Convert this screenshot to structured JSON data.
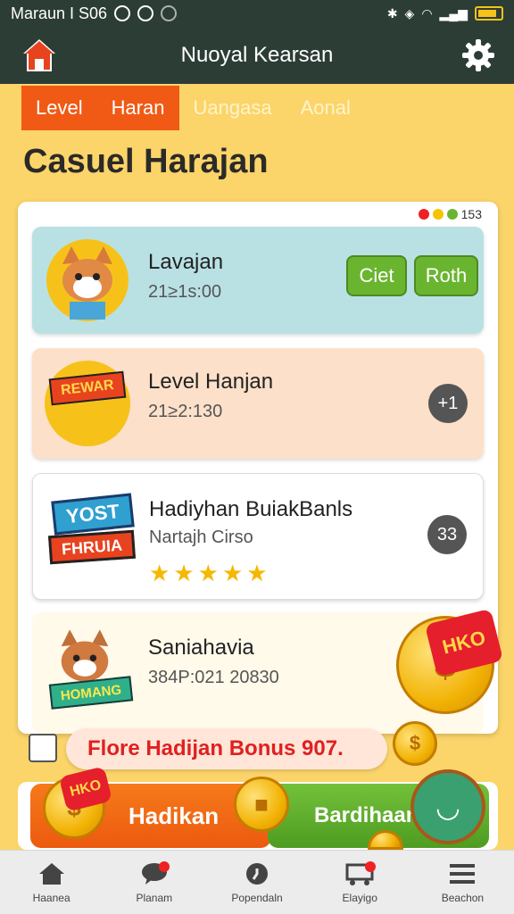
{
  "status": {
    "left_text": "Maraun I S06",
    "battery_pct": 70
  },
  "app": {
    "title": "Nuoyal Kearsan"
  },
  "tabs": [
    {
      "label": "Level",
      "active": true
    },
    {
      "label": "Haran",
      "active": true
    },
    {
      "label": "Uangasa",
      "active": false
    },
    {
      "label": "Aonal",
      "active": false
    }
  ],
  "section": {
    "title": "Casuel Harajan"
  },
  "panel": {
    "stats_count": "153"
  },
  "cards": [
    {
      "title": "Lavajan",
      "sub": "21≥1s:00",
      "btn1": "Ciet",
      "btn2": "Roth"
    },
    {
      "title": "Level Hanjan",
      "sub": "21≥2:130",
      "badge": "+1",
      "sign": "REWAR"
    },
    {
      "title": "Hadiyhan BuiakBanls",
      "sub": "Nartajh Cirso",
      "badge": "33",
      "stars": 5,
      "sign_top": "YOST",
      "sign_bottom": "FHRUIA"
    },
    {
      "title": "Saniahavia",
      "sub": "384P:021 20830",
      "sign": "HOMANG"
    }
  ],
  "bonus": {
    "label": "Flore Hadijan Bonus 907."
  },
  "coins": {
    "big_tag": "HKO",
    "bottom_tag": "HKO"
  },
  "bottom_buttons": {
    "left": "Hadikan",
    "right": "Bardihaan"
  },
  "nav": [
    {
      "label": "Haanea",
      "icon": "home-icon",
      "dot": false
    },
    {
      "label": "Planam",
      "icon": "chat-icon",
      "dot": true
    },
    {
      "label": "Popendaln",
      "icon": "refresh-icon",
      "dot": false
    },
    {
      "label": "Elayigo",
      "icon": "cart-icon",
      "dot": true
    },
    {
      "label": "Beachon",
      "icon": "menu-icon",
      "dot": false
    }
  ],
  "colors": {
    "accent": "#f05a15",
    "header": "#2c3d36",
    "green": "#6ab530",
    "coin": "#f2b305"
  }
}
